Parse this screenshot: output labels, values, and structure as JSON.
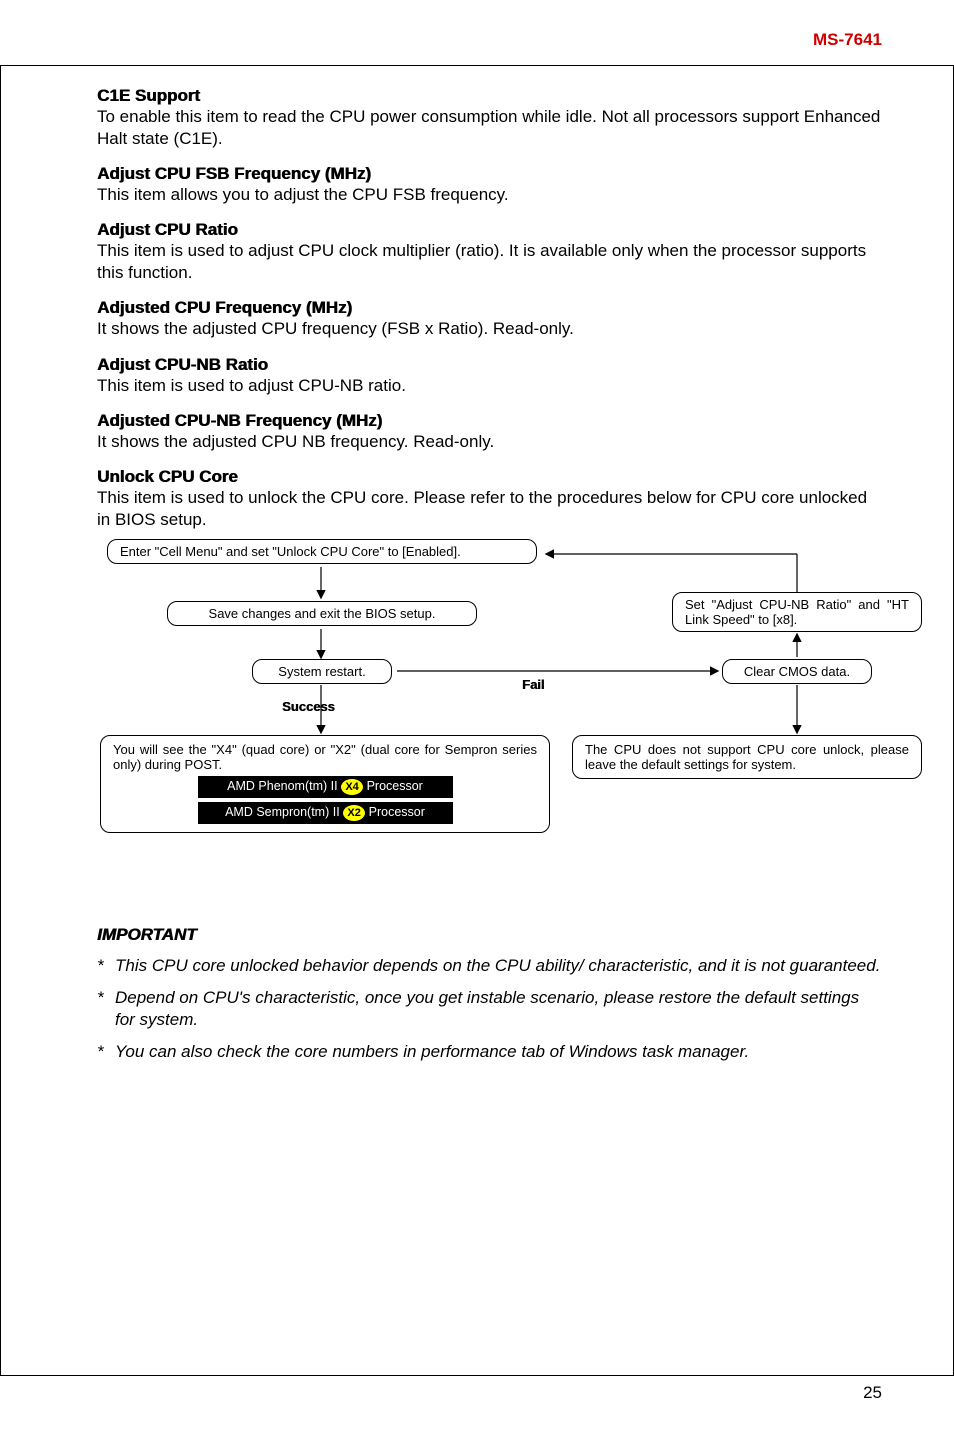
{
  "header": {
    "model": "MS-7641"
  },
  "footer": {
    "page": "25"
  },
  "sections": {
    "s1_title": "C1E Support",
    "s1_body": "To enable this item to read the CPU power consumption while idle. Not all processors support Enhanced Halt state (C1E).",
    "s2_title": "Adjust CPU FSB Frequency (MHz)",
    "s2_body": "This item allows you to adjust the CPU FSB frequency.",
    "s3_title": "Adjust CPU Ratio",
    "s3_body": "This item is used to adjust CPU clock multiplier (ratio). It is available only when the processor supports this function.",
    "s4_title": "Adjusted CPU Frequency (MHz)",
    "s4_body": "It shows the adjusted CPU frequency (FSB x Ratio). Read-only.",
    "s5_title": "Adjust CPU-NB Ratio",
    "s5_body": "This item is used to adjust CPU-NB ratio.",
    "s6_title": "Adjusted CPU-NB Frequency (MHz)",
    "s6_body": "It shows the adjusted CPU NB frequency. Read-only.",
    "s7_title": "Unlock CPU Core",
    "s7_body": "This item is used to unlock the CPU core. Please refer to the procedures below for CPU core unlocked in BIOS setup."
  },
  "flow": {
    "step1": "Enter \"Cell Menu\" and set \"Unlock CPU Core\" to [Enabled].",
    "step2": "Save changes and exit the BIOS setup.",
    "step3": "System restart.",
    "step4": "Set \"Adjust CPU-NB Ratio\" and \"HT Link Speed\" to [x8].",
    "step5": "Clear CMOS data.",
    "success_label": "Success",
    "fail_label": "Fail",
    "outcome_ok": "You will see the \"X4\" (quad core) or \"X2\" (dual core for Sempron series only) during POST.",
    "outcome_fail": "The CPU does not support CPU core unlock, please leave the default settings for system.",
    "bar1_pre": "AMD Phenom(tm) II",
    "bar1_mid": "X4",
    "bar1_post": "Processor",
    "bar2_pre": "AMD Sempron(tm) II",
    "bar2_mid": "X2",
    "bar2_post": "Processor"
  },
  "important": {
    "head": "IMPORTANT",
    "b1": "This CPU core unlocked behavior depends on the CPU ability/ characteristic, and it is not guaranteed.",
    "b2": "Depend on CPU's characteristic, once you get instable scenario, please restore the default settings for system.",
    "b3": "You can also check the core numbers in performance tab of Windows task manager."
  }
}
